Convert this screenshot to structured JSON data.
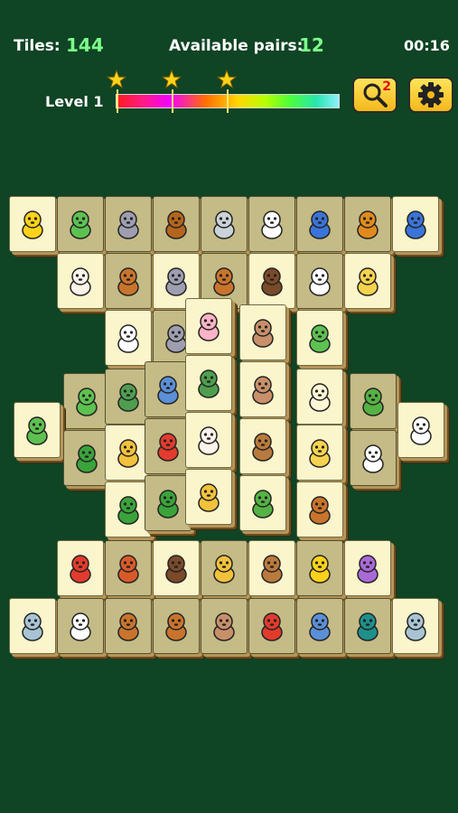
{
  "hud": {
    "tiles_label": "Tiles:",
    "tiles_value": "144",
    "pairs_label": "Available pairs:",
    "pairs_value": "12",
    "timer": "00:16",
    "level_label": "Level 1",
    "stars_earned": 3,
    "hint_count": "2"
  },
  "colors": {
    "background": "#0f4424",
    "tile_face": "#fbf5cc",
    "tile_blocked": "#c4bb86",
    "button": "#f4b81c",
    "value_text": "#7dff8a"
  },
  "tiles": [
    {
      "animal": "chick",
      "blocked": false
    },
    {
      "animal": "dinosaur",
      "blocked": true
    },
    {
      "animal": "koala",
      "blocked": true
    },
    {
      "animal": "reindeer",
      "blocked": true
    },
    {
      "animal": "seal",
      "blocked": true
    },
    {
      "animal": "panda",
      "blocked": true
    },
    {
      "animal": "penguin",
      "blocked": true
    },
    {
      "animal": "lion",
      "blocked": true
    },
    {
      "animal": "penguin",
      "blocked": false
    },
    {
      "animal": "cat",
      "blocked": false
    },
    {
      "animal": "dog",
      "blocked": true
    },
    {
      "animal": "koala",
      "blocked": false
    },
    {
      "animal": "dog",
      "blocked": true
    },
    {
      "animal": "bat",
      "blocked": false
    },
    {
      "animal": "cow",
      "blocked": true
    },
    {
      "animal": "pony",
      "blocked": false
    },
    {
      "animal": "panda",
      "blocked": false
    },
    {
      "animal": "koala",
      "blocked": true
    },
    {
      "animal": "pig",
      "blocked": false
    },
    {
      "animal": "monkey",
      "blocked": false
    },
    {
      "animal": "dinosaur",
      "blocked": false
    },
    {
      "animal": "dinosaur",
      "blocked": true
    },
    {
      "animal": "turtle",
      "blocked": true
    },
    {
      "animal": "elephant",
      "blocked": true
    },
    {
      "animal": "turtle",
      "blocked": false
    },
    {
      "animal": "monkey",
      "blocked": false
    },
    {
      "animal": "sheep",
      "blocked": false
    },
    {
      "animal": "chameleon",
      "blocked": true
    },
    {
      "animal": "dinosaur",
      "blocked": false
    },
    {
      "animal": "crocodile",
      "blocked": true
    },
    {
      "animal": "squirrel",
      "blocked": false
    },
    {
      "animal": "parrot",
      "blocked": true
    },
    {
      "animal": "cat",
      "blocked": false
    },
    {
      "animal": "owl",
      "blocked": false
    },
    {
      "animal": "pony",
      "blocked": false
    },
    {
      "animal": "panda",
      "blocked": true
    },
    {
      "animal": "rabbit",
      "blocked": false
    },
    {
      "animal": "crocodile",
      "blocked": false
    },
    {
      "animal": "crocodile",
      "blocked": true
    },
    {
      "animal": "squirrel",
      "blocked": false
    },
    {
      "animal": "chameleon",
      "blocked": false
    },
    {
      "animal": "dog",
      "blocked": false
    },
    {
      "animal": "parrot",
      "blocked": false
    },
    {
      "animal": "fox",
      "blocked": true
    },
    {
      "animal": "bat",
      "blocked": false
    },
    {
      "animal": "squirrel",
      "blocked": true
    },
    {
      "animal": "owl",
      "blocked": false
    },
    {
      "animal": "chick",
      "blocked": true
    },
    {
      "animal": "rhino",
      "blocked": false
    },
    {
      "animal": "hippo",
      "blocked": false
    },
    {
      "animal": "cow",
      "blocked": true
    },
    {
      "animal": "dog",
      "blocked": true
    },
    {
      "animal": "dog",
      "blocked": true
    },
    {
      "animal": "monkey",
      "blocked": true
    },
    {
      "animal": "parrot",
      "blocked": true
    },
    {
      "animal": "elephant",
      "blocked": true
    },
    {
      "animal": "peacock",
      "blocked": true
    },
    {
      "animal": "hippo",
      "blocked": false
    }
  ]
}
